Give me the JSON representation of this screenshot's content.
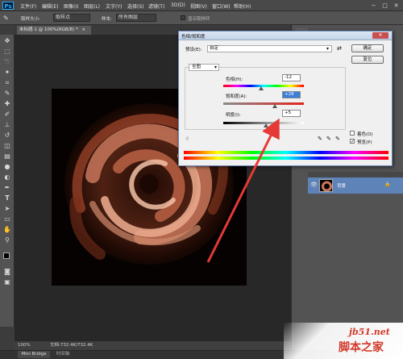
{
  "app": {
    "logo": "Ps",
    "menu": [
      "文件(F)",
      "编辑(E)",
      "图像(I)",
      "图层(L)",
      "文字(Y)",
      "选择(S)",
      "滤镜(T)",
      "3D(D)",
      "视图(V)",
      "窗口(W)",
      "帮助(H)"
    ],
    "window_controls": {
      "minimize": "−",
      "restore": "□",
      "close": "✕"
    }
  },
  "options": {
    "size_label": "取样大小:",
    "size_value": "取样点",
    "sample_label": "样本:",
    "sample_value": "所有图层",
    "show_ring": "显示取样环"
  },
  "document": {
    "tab_title": "未标题-1 @ 100%(RGB/8) *",
    "close": "×"
  },
  "status": {
    "zoom": "100%",
    "doc_info": "文档:732.4K/732.4K"
  },
  "bottom": {
    "mini_bridge": "Mini Bridge",
    "timeline": "时间轴"
  },
  "layers": {
    "layer_name": "背景",
    "eye": "👁",
    "lock": "🔒"
  },
  "dialog": {
    "title": "色相/饱和度",
    "close": "✕",
    "preset_label": "预设(E):",
    "preset_value": "自定",
    "channel_value": "全图",
    "hue_label": "色相(H):",
    "hue_value": "-12",
    "saturation_label": "饱和度(A):",
    "saturation_value": "+28",
    "lightness_label": "明度(I):",
    "lightness_value": "+5",
    "ok_label": "确定",
    "cancel_label": "复位",
    "colorize_label": "着色(O)",
    "preview_label": "预览(P)",
    "preview_checked": "✓",
    "hand_icon_label": "☝"
  },
  "watermark": {
    "line1": "jb51.net",
    "line2": "脚本之家"
  },
  "colors": {
    "accent": "#31a8ff",
    "dialog_border": "#6a87b6",
    "arrow": "#e53935",
    "layer_selected": "#5d83b8"
  }
}
